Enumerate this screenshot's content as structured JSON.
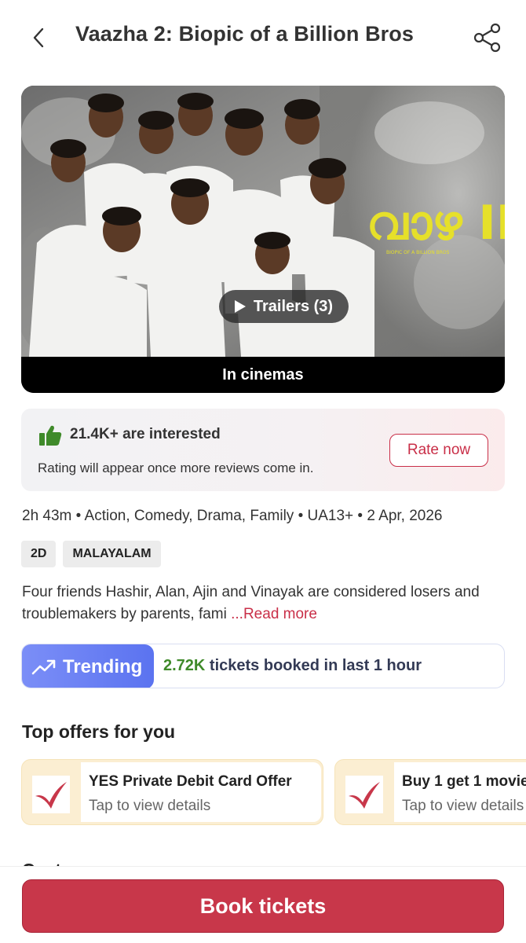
{
  "header": {
    "title": "Vaazha 2: Biopic of a Billion Bros"
  },
  "poster": {
    "trailer_label": "Trailers (3)",
    "status_label": "In cinemas",
    "logo_text": "വാഴ II",
    "logo_subtext": "BIOPIC OF A BILLION BROS"
  },
  "interest": {
    "count_text": "21.4K+ are interested",
    "note": "Rating will appear once more reviews come in.",
    "rate_label": "Rate now"
  },
  "meta": {
    "line": "2h 43m • Action, Comedy, Drama, Family • UA13+ • 2 Apr, 2026"
  },
  "tags": [
    "2D",
    "MALAYALAM"
  ],
  "synopsis": {
    "text": "Four friends Hashir, Alan, Ajin and Vinayak are considered losers and troublemakers by parents, fami ",
    "read_more": "...Read more"
  },
  "trending": {
    "badge": "Trending",
    "count": "2.72K",
    "text": " tickets booked in last 1 hour"
  },
  "offers": {
    "title": "Top offers for you",
    "items": [
      {
        "title": "YES Private Debit Card Offer",
        "subtitle": "Tap to view details"
      },
      {
        "title": "Buy 1 get 1 movie",
        "subtitle": "Tap to view details"
      }
    ]
  },
  "cast": {
    "title": "Cast"
  },
  "footer": {
    "book_label": "Book tickets"
  },
  "colors": {
    "brand_red": "#c8374a",
    "trending_blue": "#5b73f0",
    "trending_green": "#3f8a2a",
    "thumb_green": "#3f8a2a",
    "offer_bg": "#fbeed2"
  },
  "icons": {
    "back": "chevron-left-icon",
    "share": "share-icon",
    "thumb": "thumbs-up-icon",
    "trend": "trending-up-icon",
    "play": "play-icon"
  }
}
